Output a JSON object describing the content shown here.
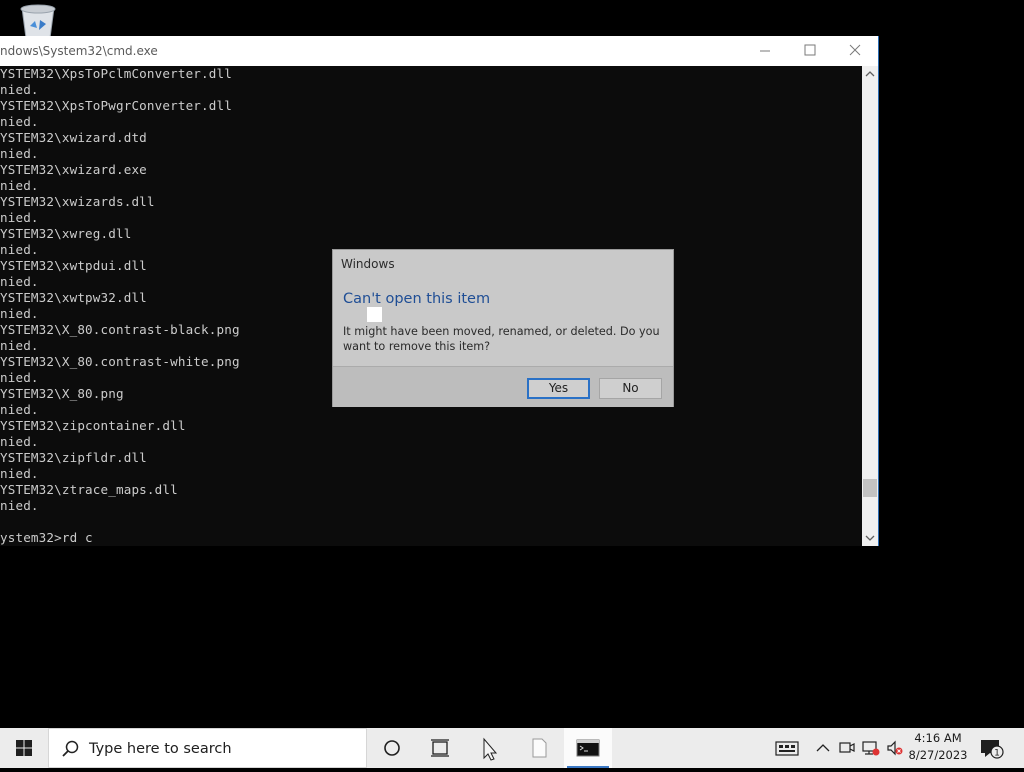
{
  "window": {
    "title": "ndows\\System32\\cmd.exe"
  },
  "console": {
    "lines": [
      "YSTEM32\\XpsToPclmConverter.dll",
      "nied.",
      "YSTEM32\\XpsToPwgrConverter.dll",
      "nied.",
      "YSTEM32\\xwizard.dtd",
      "nied.",
      "YSTEM32\\xwizard.exe",
      "nied.",
      "YSTEM32\\xwizards.dll",
      "nied.",
      "YSTEM32\\xwreg.dll",
      "nied.",
      "YSTEM32\\xwtpdui.dll",
      "nied.",
      "YSTEM32\\xwtpw32.dll",
      "nied.",
      "YSTEM32\\X_80.contrast-black.png",
      "nied.",
      "YSTEM32\\X_80.contrast-white.png",
      "nied.",
      "YSTEM32\\X_80.png",
      "nied.",
      "YSTEM32\\zipcontainer.dll",
      "nied.",
      "YSTEM32\\zipfldr.dll",
      "nied.",
      "YSTEM32\\ztrace_maps.dll",
      "nied.",
      ""
    ],
    "prompt": "ystem32>rd c"
  },
  "dialog": {
    "title": "Windows",
    "heading": "Can't open this item",
    "message": "It might have been moved, renamed, or deleted. Do you want to remove this item?",
    "yes_label": "Yes",
    "no_label": "No"
  },
  "taskbar": {
    "search_placeholder": "Type here to search",
    "time": "4:16 AM",
    "date": "8/27/2023",
    "notification_count": "1",
    "accent_color": "#3a78c4"
  }
}
